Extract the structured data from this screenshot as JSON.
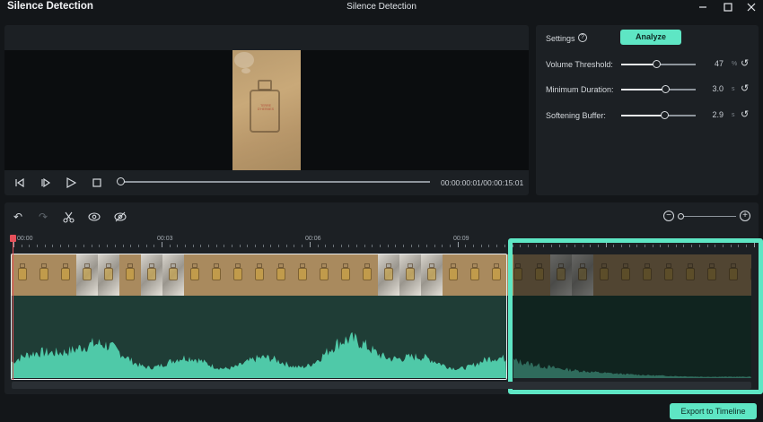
{
  "window": {
    "app_title": "Silence Detection",
    "center_title": "Silence Detection",
    "controls": [
      "minimize-icon",
      "maximize-icon",
      "close-icon"
    ]
  },
  "player": {
    "timecode": "00:00:00:01/00:00:15:01",
    "progress": 0.0,
    "thumbnail_text": "TERRE D'HERMES",
    "controls": [
      "previous-frame-icon",
      "next-frame-icon",
      "play-icon",
      "stop-icon"
    ]
  },
  "settings": {
    "label": "Settings",
    "analyze_label": "Analyze",
    "rows": [
      {
        "label": "Volume Threshold:",
        "value": "47",
        "unit": "%",
        "fraction": 0.47
      },
      {
        "label": "Minimum Duration:",
        "value": "3.0",
        "unit": "s",
        "fraction": 0.59
      },
      {
        "label": "Softening Buffer:",
        "value": "2.9",
        "unit": "s",
        "fraction": 0.58
      }
    ]
  },
  "timeline": {
    "tools": [
      "undo-icon",
      "redo-icon",
      "scissors-icon",
      "eye-icon",
      "eye-off-icon"
    ],
    "ruler_labels": [
      "00:00",
      "00:03",
      "00:06",
      "00:09"
    ],
    "zoom_level": 0.0
  },
  "export": {
    "label": "Export to Timeline"
  },
  "colors": {
    "accent": "#5ee6c4",
    "playhead": "#e6505a",
    "waveform": "#4fc9a8",
    "waveform_silent": "#2f6b5c"
  }
}
